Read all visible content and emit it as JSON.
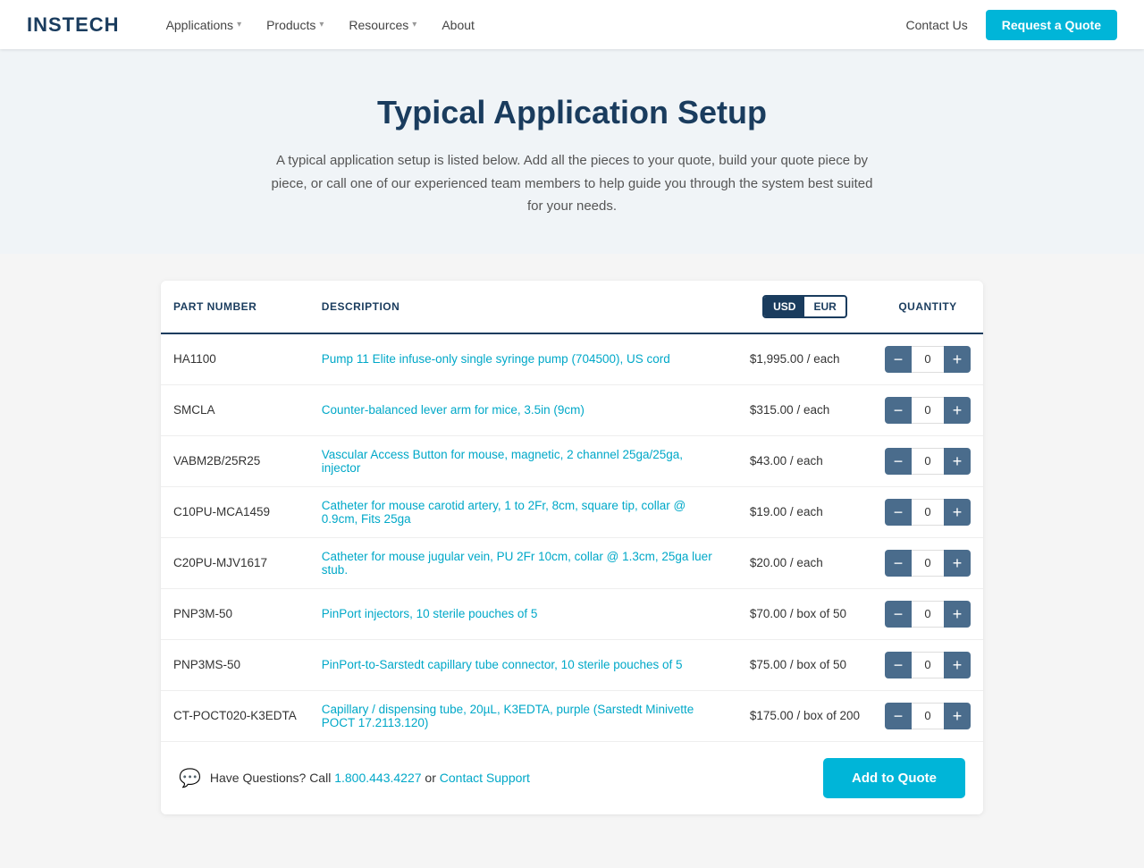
{
  "navbar": {
    "logo_text": "INSTECH",
    "nav_items": [
      {
        "label": "Applications",
        "has_dropdown": true
      },
      {
        "label": "Products",
        "has_dropdown": true
      },
      {
        "label": "Resources",
        "has_dropdown": true
      },
      {
        "label": "About",
        "has_dropdown": false
      }
    ],
    "contact_label": "Contact Us",
    "cta_label": "Request a Quote"
  },
  "hero": {
    "title": "Typical Application Setup",
    "description": "A typical application setup is listed below. Add all the pieces to your quote, build your quote piece by piece, or call one of our experienced team members to help guide you through the system best suited for your needs."
  },
  "table": {
    "headers": {
      "part_number": "PART NUMBER",
      "description": "DESCRIPTION",
      "currency_usd": "USD",
      "currency_eur": "EUR",
      "quantity": "QUANTITY"
    },
    "rows": [
      {
        "part": "HA1100",
        "description": "Pump 11 Elite infuse-only single syringe pump (704500), US cord",
        "price": "$1,995.00 / each",
        "qty": 0
      },
      {
        "part": "SMCLA",
        "description": "Counter-balanced lever arm for mice, 3.5in (9cm)",
        "price": "$315.00 / each",
        "qty": 0
      },
      {
        "part": "VABM2B/25R25",
        "description": "Vascular Access Button for mouse, magnetic, 2 channel 25ga/25ga, injector",
        "price": "$43.00 / each",
        "qty": 0
      },
      {
        "part": "C10PU-MCA1459",
        "description": "Catheter for mouse carotid artery, 1 to 2Fr, 8cm, square tip, collar @ 0.9cm, Fits 25ga",
        "price": "$19.00 / each",
        "qty": 0
      },
      {
        "part": "C20PU-MJV1617",
        "description": "Catheter for mouse jugular vein, PU 2Fr 10cm, collar @ 1.3cm, 25ga luer stub.",
        "price": "$20.00 / each",
        "qty": 0
      },
      {
        "part": "PNP3M-50",
        "description": "PinPort injectors, 10 sterile pouches of 5",
        "price": "$70.00 / box of 50",
        "qty": 0
      },
      {
        "part": "PNP3MS-50",
        "description": "PinPort-to-Sarstedt capillary tube connector, 10 sterile pouches of 5",
        "price": "$75.00 / box of 50",
        "qty": 0
      },
      {
        "part": "CT-POCT020-K3EDTA",
        "description": "Capillary / dispensing tube, 20µL, K3EDTA, purple (Sarstedt Minivette POCT 17.2113.120)",
        "price": "$175.00 / box of 200",
        "qty": 0
      }
    ]
  },
  "footer": {
    "questions_text": "Have Questions? Call ",
    "phone": "1.800.443.4227",
    "or_text": " or ",
    "support_label": "Contact Support",
    "add_to_quote_label": "Add to Quote"
  }
}
